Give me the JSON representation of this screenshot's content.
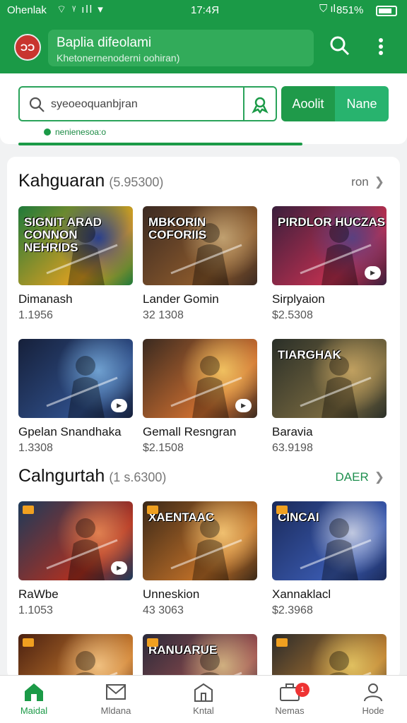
{
  "status_bar": {
    "carrier": "Ohenlak",
    "time": "17:4Я",
    "battery": "851%"
  },
  "app_bar": {
    "avatar_text": "ƆƆ",
    "title": "Baplia difeolami",
    "subtitle": "Khetonernenoderni oohiran)"
  },
  "search": {
    "value": "syeoeoquanbjran",
    "button_primary": "Aoolit",
    "button_secondary": "Nane",
    "status_text": "nenienesoa:o"
  },
  "sections": [
    {
      "title": "Kahguaran",
      "count": "(5.95300)",
      "more": "ron",
      "items": [
        {
          "name": "Dimanash",
          "price": "1.1956",
          "art_label": "SIGNIT ARAD CONNON NEHRIDS",
          "colors": [
            "#1f7a3a",
            "#e0a020",
            "#2a3f8c"
          ]
        },
        {
          "name": "Lander Gomin",
          "price": "32 1308",
          "art_label": "MBKORIN COFORIIS",
          "colors": [
            "#3b2a22",
            "#8c5a2c",
            "#c0a070"
          ]
        },
        {
          "name": "Sirplyaion",
          "price": "$2.5308",
          "art_label": "PIRDLOR HUCZAS",
          "colors": [
            "#3a1f3c",
            "#c03050",
            "#5a4080"
          ]
        },
        {
          "name": "Gpelan Snandhaka",
          "price": "1.3308",
          "art_label": "",
          "colors": [
            "#16203a",
            "#2f4f8a",
            "#6fa0d0"
          ]
        },
        {
          "name": "Gemall Resngran",
          "price": "$2.1508",
          "art_label": "",
          "colors": [
            "#3a2a20",
            "#d07030",
            "#f0c060"
          ]
        },
        {
          "name": "Baravia",
          "price": "63.9198",
          "art_label": "TIARGHAK",
          "colors": [
            "#2a2f28",
            "#7a6a40",
            "#c0a060"
          ]
        }
      ]
    },
    {
      "title": "Calngurtah",
      "count": "(1 s.6300)",
      "more": "DAER",
      "items": [
        {
          "name": "RaWbe",
          "price": "1.1053",
          "art_label": "",
          "colors": [
            "#1c3a5a",
            "#b03020",
            "#e08050"
          ]
        },
        {
          "name": "Unneskion",
          "price": "43 3063",
          "art_label": "XAENTAAC",
          "colors": [
            "#3a2818",
            "#c07028",
            "#f0c070"
          ]
        },
        {
          "name": "Xannaklacl",
          "price": "$2.3968",
          "art_label": "CINCAI",
          "colors": [
            "#1a2a5a",
            "#3a5ab0",
            "#c0c8e0"
          ]
        },
        {
          "name": "",
          "price": "",
          "art_label": "",
          "colors": [
            "#4a2010",
            "#d08030",
            "#f0c080"
          ]
        },
        {
          "name": "",
          "price": "",
          "art_label": "RANUARUE",
          "colors": [
            "#2a2a3a",
            "#a05050",
            "#d0b080"
          ]
        },
        {
          "name": "",
          "price": "",
          "art_label": "",
          "colors": [
            "#2a2a2a",
            "#c08030",
            "#e0c060"
          ]
        }
      ]
    }
  ],
  "nav": [
    {
      "label": "Maidal",
      "icon": "home-icon",
      "active": true
    },
    {
      "label": "Mldana",
      "icon": "mail-icon",
      "active": false
    },
    {
      "label": "Kntal",
      "icon": "building-icon",
      "active": false
    },
    {
      "label": "Nemas",
      "icon": "briefcase-icon",
      "active": false,
      "badge": "1"
    },
    {
      "label": "Hode",
      "icon": "profile-icon",
      "active": false
    }
  ],
  "colors": {
    "brand": "#1b9a47",
    "accent": "#28b36e"
  }
}
